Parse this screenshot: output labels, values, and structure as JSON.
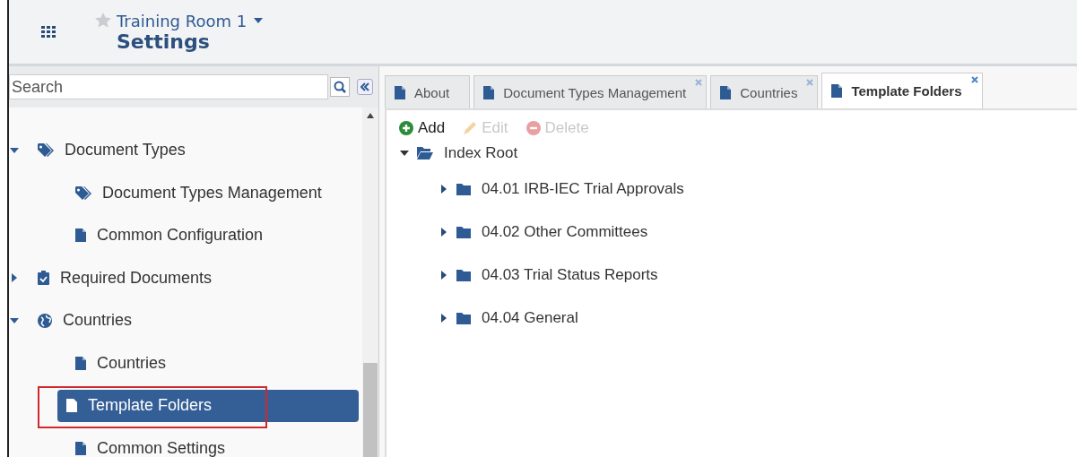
{
  "header": {
    "workspace": "Training Room 1",
    "title": "Settings",
    "favorite": false
  },
  "sidebar": {
    "search": {
      "placeholder": "Search"
    },
    "items": [
      {
        "label": "Document Types",
        "kind": "tag",
        "expanded": true,
        "selected": false,
        "annotated": false,
        "children": [
          {
            "label": "Document Types Management",
            "kind": "tag",
            "selected": false,
            "annotated": false
          },
          {
            "label": "Common Configuration",
            "kind": "page",
            "selected": false,
            "annotated": false
          }
        ]
      },
      {
        "label": "Required Documents",
        "kind": "checklist",
        "expanded": false,
        "selected": false,
        "annotated": false
      },
      {
        "label": "Countries",
        "kind": "globe",
        "expanded": true,
        "selected": false,
        "annotated": false,
        "children": [
          {
            "label": "Countries",
            "kind": "page",
            "selected": false,
            "annotated": false
          },
          {
            "label": "Template Folders",
            "kind": "page",
            "selected": true,
            "annotated": true
          },
          {
            "label": "Common Settings",
            "kind": "page",
            "selected": false,
            "annotated": false
          }
        ]
      }
    ]
  },
  "tabs": [
    {
      "label": "About",
      "selected": false,
      "closable": false
    },
    {
      "label": "Document Types Management",
      "selected": false,
      "closable": true
    },
    {
      "label": "Countries",
      "selected": false,
      "closable": true
    },
    {
      "label": "Template Folders",
      "selected": true,
      "closable": true
    }
  ],
  "toolbar": [
    {
      "label": "Add",
      "kind": "add",
      "disabled": false
    },
    {
      "label": "Edit",
      "kind": "edit",
      "disabled": true
    },
    {
      "label": "Delete",
      "kind": "delete",
      "disabled": true
    }
  ],
  "folders": {
    "label": "Index Root",
    "expanded": true,
    "children": [
      {
        "label": "04.01 IRB-IEC Trial Approvals",
        "expanded": false
      },
      {
        "label": "04.02 Other Committees",
        "expanded": false
      },
      {
        "label": "04.03 Trial Status Reports",
        "expanded": false
      },
      {
        "label": "04.04 General",
        "expanded": false
      }
    ]
  }
}
